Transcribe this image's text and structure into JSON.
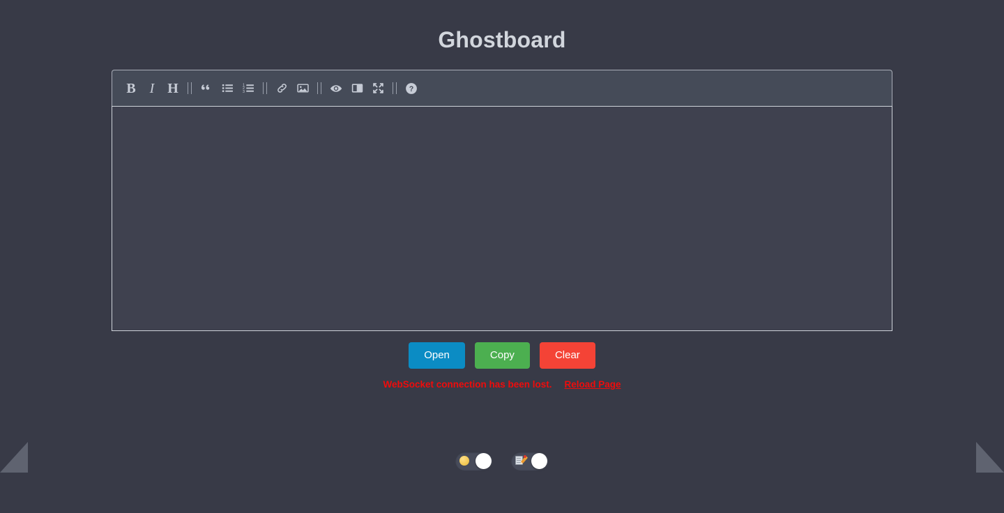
{
  "app": {
    "title": "Ghostboard",
    "background_color": "#383a47",
    "editor_background_color": "#3f414f",
    "toolbar_background_color": "#454b58"
  },
  "toolbar": {
    "items": [
      {
        "type": "button",
        "name": "bold-icon",
        "glyph": "B",
        "tooltip": "Bold"
      },
      {
        "type": "button",
        "name": "italic-icon",
        "glyph": "I",
        "tooltip": "Italic"
      },
      {
        "type": "button",
        "name": "heading-icon",
        "glyph": "H",
        "tooltip": "Heading"
      },
      {
        "type": "separator",
        "name": "toolbar-separator-1"
      },
      {
        "type": "button",
        "name": "quote-icon",
        "glyph": "“",
        "tooltip": "Quote"
      },
      {
        "type": "button",
        "name": "unordered-list-icon",
        "glyph": "",
        "tooltip": "Generic List"
      },
      {
        "type": "button",
        "name": "ordered-list-icon",
        "glyph": "",
        "tooltip": "Numbered List"
      },
      {
        "type": "separator",
        "name": "toolbar-separator-2"
      },
      {
        "type": "button",
        "name": "link-icon",
        "glyph": "",
        "tooltip": "Create Link"
      },
      {
        "type": "button",
        "name": "image-icon",
        "glyph": "",
        "tooltip": "Insert Image"
      },
      {
        "type": "separator",
        "name": "toolbar-separator-3"
      },
      {
        "type": "button",
        "name": "preview-eye-icon",
        "glyph": "",
        "tooltip": "Toggle Preview"
      },
      {
        "type": "button",
        "name": "side-by-side-icon",
        "glyph": "",
        "tooltip": "Toggle Side by Side"
      },
      {
        "type": "button",
        "name": "fullscreen-icon",
        "glyph": "",
        "tooltip": "Toggle Fullscreen"
      },
      {
        "type": "separator",
        "name": "toolbar-separator-4"
      },
      {
        "type": "button",
        "name": "help-icon",
        "glyph": "?",
        "tooltip": "Markdown Guide"
      }
    ]
  },
  "editor": {
    "value": "",
    "placeholder": ""
  },
  "actions": {
    "open_label": "Open",
    "copy_label": "Copy",
    "clear_label": "Clear",
    "open_color": "#0b8cc4",
    "copy_color": "#4caf50",
    "clear_color": "#f44336"
  },
  "status": {
    "message": "WebSocket connection has been lost.",
    "reload_label": "Reload Page",
    "color": "#f00b0b"
  },
  "toggles": [
    {
      "name": "theme-toggle",
      "icon": "full-moon-emoji",
      "state": "on"
    },
    {
      "name": "editor-toggle",
      "icon": "memo-emoji",
      "state": "on"
    }
  ]
}
